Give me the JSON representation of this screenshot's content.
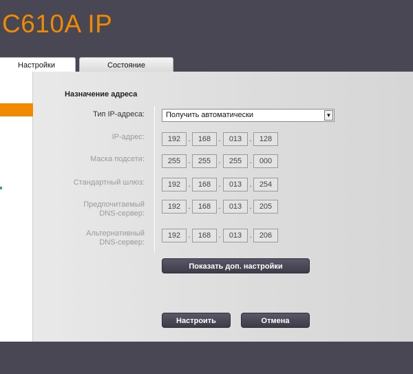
{
  "header": {
    "brand": "C610A IP"
  },
  "tabs": [
    {
      "label": "Настройки",
      "active": true
    },
    {
      "label": "Состояние",
      "active": false
    }
  ],
  "form": {
    "section_title": "Назначение адреса",
    "ip_type": {
      "label": "Тип IP-адреса:",
      "value": "Получить автоматически"
    },
    "ip_address": {
      "label": "IP-адрес:",
      "octets": [
        "192",
        "168",
        "013",
        "128"
      ]
    },
    "subnet_mask": {
      "label": "Маска подсети:",
      "octets": [
        "255",
        "255",
        "255",
        "000"
      ]
    },
    "gateway": {
      "label": "Стандартный шлюз:",
      "octets": [
        "192",
        "168",
        "013",
        "254"
      ]
    },
    "preferred_dns": {
      "label_line1": "Предпочитаемый",
      "label_line2": "DNS-сервер:",
      "octets": [
        "192",
        "168",
        "013",
        "205"
      ]
    },
    "alternate_dns": {
      "label_line1": "Альтернативный",
      "label_line2": "DNS-сервер:",
      "octets": [
        "192",
        "168",
        "013",
        "206"
      ]
    },
    "advanced_button": "Показать доп. настройки",
    "apply_button": "Настроить",
    "cancel_button": "Отмена"
  },
  "colors": {
    "accent": "#f08a00",
    "chrome": "#4a4754"
  }
}
